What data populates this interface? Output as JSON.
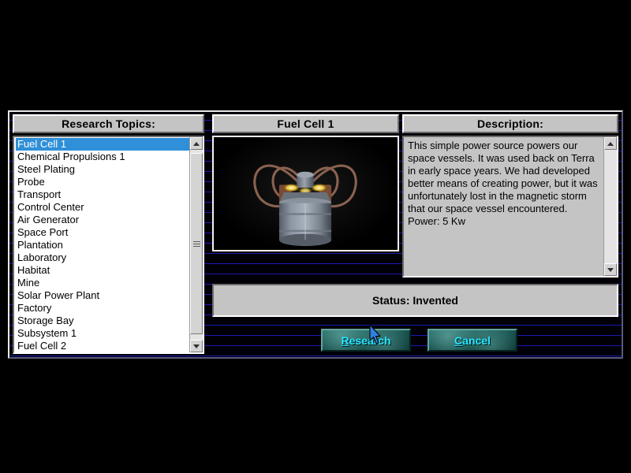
{
  "window": {
    "background_color": "#000000",
    "stripe_color": "#1a1ab4"
  },
  "topics": {
    "header": "Research Topics:",
    "selected_index": 0,
    "items": [
      "Fuel Cell 1",
      "Chemical Propulsions 1",
      "Steel Plating",
      "Probe",
      "Transport",
      "Control Center",
      "Air Generator",
      "Space Port",
      "Plantation",
      "Laboratory",
      "Habitat",
      "Mine",
      "Solar Power Plant",
      "Factory",
      "Storage Bay",
      "Subsystem 1",
      "Fuel Cell 2"
    ],
    "scrollbar": {
      "up_arrow": "scroll-up-arrow-icon",
      "down_arrow": "scroll-down-arrow-icon",
      "thumb_grip": "scrollbar-grip-icon"
    }
  },
  "item": {
    "header": "Fuel Cell 1",
    "image_alt": "fuel-cell-render"
  },
  "description": {
    "header": "Description:",
    "text": "This simple power source powers our space vessels.  It was used back on Terra in early space years. We had developed better means of creating power, but it was unfortunately lost in the magnetic storm that our space vessel encountered.  Power: 5 Kw",
    "scrollbar": {
      "up_arrow": "scroll-up-arrow-icon",
      "down_arrow": "scroll-down-arrow-icon"
    }
  },
  "status": {
    "text": "Status: Invented"
  },
  "actions": {
    "research": {
      "accel": "R",
      "rest": "esearch"
    },
    "cancel": {
      "accel": "C",
      "rest": "ancel"
    },
    "text_color": "#27e5ff"
  },
  "cursor": {
    "name": "mouse-pointer",
    "color": "#2f7fe0"
  }
}
